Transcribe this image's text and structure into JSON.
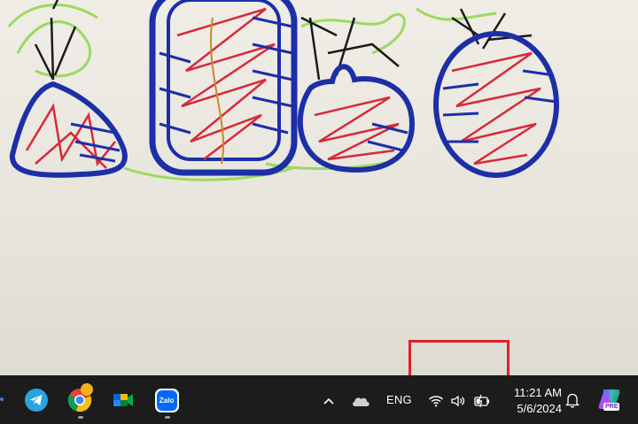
{
  "taskbar": {
    "pinned_apps": [
      {
        "name": "Telegram",
        "icon": "telegram-icon"
      },
      {
        "name": "Google Chrome",
        "icon": "chrome-icon"
      },
      {
        "name": "Google Meet",
        "icon": "google-meet-icon"
      },
      {
        "name": "Zalo",
        "icon": "zalo-icon",
        "label": "Zalo"
      }
    ],
    "tray": {
      "overflow_icon": "chevron-up-icon",
      "cloud_icon": "onedrive-cloud-icon",
      "language": "ENG",
      "wifi_icon": "wifi-icon",
      "volume_icon": "speaker-icon",
      "battery_icon": "battery-charging-icon",
      "time": "11:21 AM",
      "date": "5/6/2024",
      "notification_icon": "bell-icon",
      "copilot_badge": "PRE"
    }
  },
  "colors": {
    "taskbar_bg": "#1c1c1c",
    "highlight": "#e0202a",
    "drawing_blue": "#1d2fa6",
    "drawing_red": "#d62a3a",
    "drawing_green": "#8fd64a"
  }
}
